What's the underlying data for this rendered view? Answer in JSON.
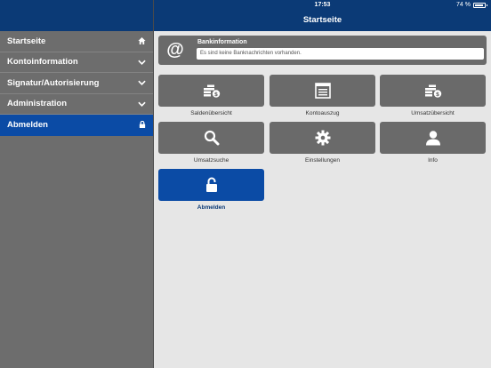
{
  "status": {
    "time": "17:53",
    "battery": "74 %"
  },
  "header": {
    "title": "Startseite"
  },
  "sidebar": {
    "items": [
      {
        "label": "Startseite"
      },
      {
        "label": "Kontoinformation"
      },
      {
        "label": "Signatur/Autorisierung"
      },
      {
        "label": "Administration"
      },
      {
        "label": "Abmelden"
      }
    ]
  },
  "bank": {
    "title": "Bankinformation",
    "message": "Es sind keine Banknachrichten vorhanden."
  },
  "tiles": [
    {
      "label": "Saldenübersicht"
    },
    {
      "label": "Kontoauszug"
    },
    {
      "label": "Umsatzübersicht"
    },
    {
      "label": "Umsatzsuche"
    },
    {
      "label": "Einstellungen"
    },
    {
      "label": "Info"
    },
    {
      "label": "Abmelden"
    }
  ],
  "colors": {
    "brand": "#0b3a76",
    "active": "#0b4ba5",
    "tile": "#6a6a6a"
  },
  "icons": {
    "sidebar": [
      "home-icon",
      "chevron-down-icon",
      "chevron-down-icon",
      "chevron-down-icon",
      "lock-icon"
    ],
    "tiles": [
      "coins-icon",
      "statement-icon",
      "coins-icon",
      "search-icon",
      "gear-icon",
      "user-icon",
      "unlock-icon"
    ]
  }
}
